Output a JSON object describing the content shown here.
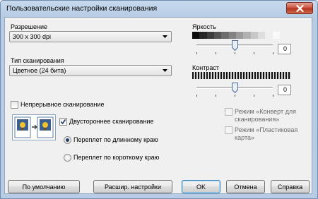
{
  "window": {
    "title": "Пользовательские настройки сканирования"
  },
  "resolution": {
    "label": "Разрешение",
    "value": "300 x 300  dpi"
  },
  "scan_type": {
    "label": "Тип сканирования",
    "value": "Цветное (24 бита)"
  },
  "brightness": {
    "label": "Яркость",
    "value": "0",
    "level_percent": 50
  },
  "contrast": {
    "label": "Контраст",
    "value": "0",
    "level_percent": 50
  },
  "continuous": {
    "label": "Непрерывное сканирование",
    "checked": false
  },
  "duplex": {
    "label": "Двустороннее сканирование",
    "checked": true,
    "long_edge_label": "Переплет по длинному краю",
    "short_edge_label": "Переплет по короткому краю",
    "selected": "long_edge"
  },
  "carrier_sheet": {
    "label_line1": "Режим «Конверт для",
    "label_line2": "сканирования»",
    "enabled": false
  },
  "plastic_card": {
    "label_line1": "Режим «Пластиковая",
    "label_line2": "карта»",
    "enabled": false
  },
  "buttons": {
    "default": "По умолчанию",
    "advanced": "Расшир. настройки",
    "ok": "OK",
    "cancel": "Отмена",
    "help": "Справка"
  },
  "colors": {
    "accent": "#3c7fb1",
    "title_bar": "#b8cde5",
    "close_button": "#c8513a"
  },
  "icons": [
    "close-icon",
    "dropdown-arrow-icon",
    "checkmark-icon",
    "duplex-pages-icon",
    "slider-thumb-icon"
  ]
}
